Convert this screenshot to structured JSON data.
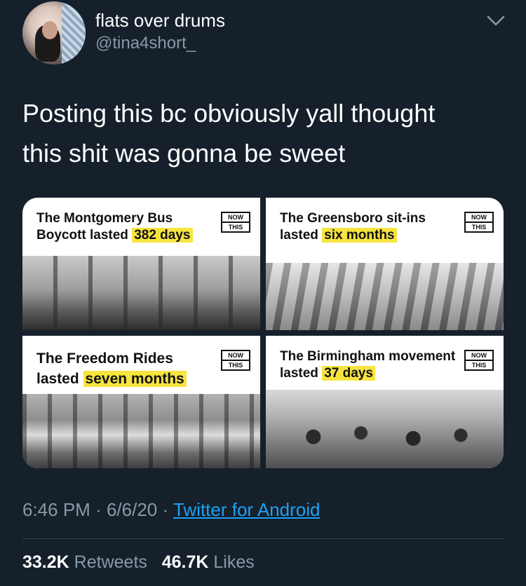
{
  "author": {
    "display_name": "flats over drums",
    "handle": "@tina4short_"
  },
  "tweet": {
    "text": "Posting this bc obviously yall thought\nthis shit was gonna be sweet"
  },
  "media": {
    "cards": [
      {
        "caption_prefix": "The Montgomery Bus Boycott lasted ",
        "highlight": "382 days",
        "badge_top": "NOW",
        "badge_bottom": "THIS"
      },
      {
        "caption_prefix": "The Greensboro sit-ins lasted ",
        "highlight": "six months",
        "badge_top": "NOW",
        "badge_bottom": "THIS"
      },
      {
        "caption_prefix": "The Freedom Rides lasted ",
        "highlight": "seven months",
        "badge_top": "NOW",
        "badge_bottom": "THIS"
      },
      {
        "caption_prefix": "The Birmingham movement lasted ",
        "highlight": "37 days",
        "badge_top": "NOW",
        "badge_bottom": "THIS"
      }
    ]
  },
  "meta": {
    "time": "6:46 PM",
    "separator": "·",
    "date": "6/6/20",
    "source": "Twitter for Android"
  },
  "stats": {
    "retweets_count": "33.2K",
    "retweets_label": "Retweets",
    "likes_count": "46.7K",
    "likes_label": "Likes"
  },
  "colors": {
    "background": "#15202b",
    "secondary_text": "#8899a6",
    "link": "#1da1f2",
    "highlight": "#f6e43f"
  },
  "icons": {
    "menu": "chevron-down-icon"
  }
}
